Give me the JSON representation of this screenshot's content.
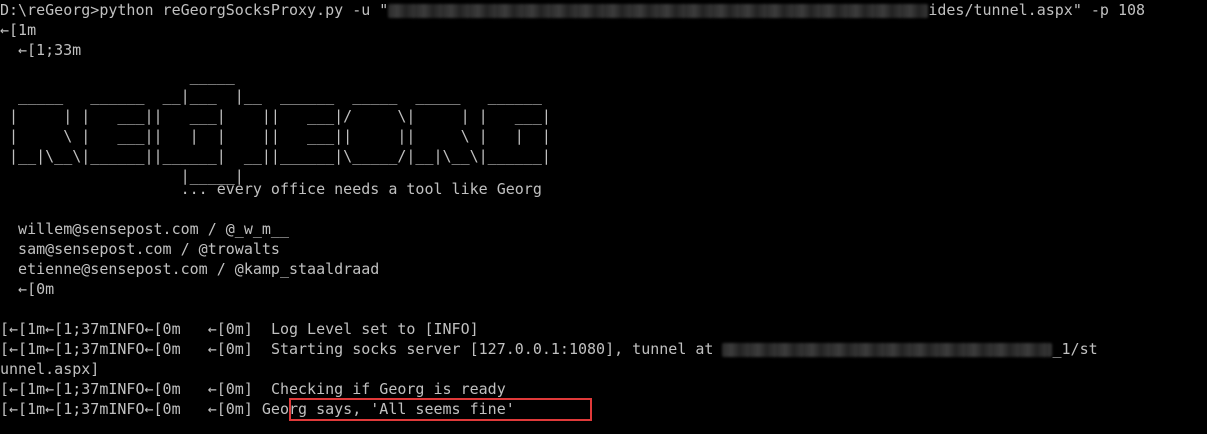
{
  "colors": {
    "background": "#000000",
    "foreground": "#c0c0c0",
    "highlight_border": "#e03a3a"
  },
  "command": {
    "prompt": "D:\\reGeorg>",
    "text": "python reGeorgSocksProxy.py -u \"",
    "tail": "ides/tunnel.aspx\" -p 108"
  },
  "escapes": {
    "bold_on": "←[1m",
    "yellow": "←[1;33m",
    "reset": "←[0m"
  },
  "banner": [
    "                     _____",
    "  _____   ______  __|___  |__  ______  _____  _____   ______",
    " |     | |   ___||   ___|    ||   ___|/     \\|     | |   ___|",
    " |     \\ |   ___||   |  |    ||   ___||     ||     \\ |   |  |",
    " |__|\\__\\|______||______|  __||______|\\_____/|__|\\__\\|______|",
    "                    |_____|",
    "                    ... every office needs a tool like Georg"
  ],
  "authors": [
    "  willem@sensepost.com / @_w_m__",
    "  sam@sensepost.com / @trowalts",
    "  etienne@sensepost.com / @kamp_staaldraad",
    "  ←[0m"
  ],
  "log": [
    {
      "prefix": "[←[1m←[1;37mINFO←[0m   ←[0m]  ",
      "message": "Log Level set to [INFO]"
    },
    {
      "prefix": "[←[1m←[1;37mINFO←[0m   ←[0m]  ",
      "message": "Starting socks server [127.0.0.1:1080], tunnel at ",
      "tail": "_1/st"
    },
    {
      "prefix": "",
      "message": "unnel.aspx]"
    },
    {
      "prefix": "[←[1m←[1;37mINFO←[0m   ←[0m]  ",
      "message": "Checking if Georg is ready"
    },
    {
      "prefix": "[←[1m←[1;37mINFO←[0m   ←[0m] ",
      "message": "Georg says, 'All seems fine'"
    }
  ]
}
